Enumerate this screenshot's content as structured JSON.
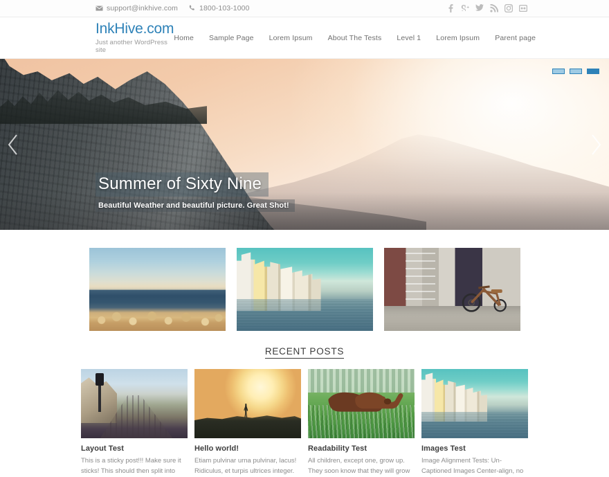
{
  "topbar": {
    "email": "support@inkhive.com",
    "phone": "1800-103-1000",
    "email_icon": "envelope-icon",
    "phone_icon": "phone-icon",
    "social": [
      {
        "name": "facebook-icon",
        "label": "f"
      },
      {
        "name": "google-plus-icon",
        "label": "g+"
      },
      {
        "name": "twitter-icon",
        "label": "t"
      },
      {
        "name": "rss-icon",
        "label": "rss"
      },
      {
        "name": "instagram-icon",
        "label": "ig"
      },
      {
        "name": "flickr-icon",
        "label": "fl"
      }
    ]
  },
  "header": {
    "site_title": "InkHive.com",
    "tagline": "Just another WordPress site",
    "nav": [
      {
        "label": "Home"
      },
      {
        "label": "Sample Page"
      },
      {
        "label": "Lorem Ipsum"
      },
      {
        "label": "About The Tests"
      },
      {
        "label": "Level 1"
      },
      {
        "label": "Lorem Ipsum"
      },
      {
        "label": "Parent page"
      }
    ]
  },
  "hero": {
    "title": "Summer of Sixty Nine",
    "subtitle": "Beautiful Weather and beautiful picture. Great Shot!",
    "prev_icon": "chevron-left-icon",
    "next_icon": "chevron-right-icon",
    "slide_count": 3,
    "active_slide": 3,
    "accent_color": "#2e82b8",
    "dot_inactive_color": "#9fcbe4",
    "image_alt": "Mountain cliff at sunset with peach sky"
  },
  "featured": [
    {
      "name": "featured-image-seascape",
      "alt": "Rocky coastline at dusk with calm sea"
    },
    {
      "name": "featured-image-canal",
      "alt": "Colourful canal houses with boats"
    },
    {
      "name": "featured-image-tricycle",
      "alt": "Vintage tricycle leaning against a brick wall"
    }
  ],
  "recent": {
    "heading": "RECENT POSTS",
    "posts": [
      {
        "title": "Layout Test",
        "excerpt": "This is a sticky post!!! Make sure it sticks! This should then split into other pages with",
        "thumb_name": "post-thumb-railway",
        "thumb_alt": "Railway track running along the coast"
      },
      {
        "title": "Hello world!",
        "excerpt": "Etiam pulvinar urna pulvinar, lacus! Ridiculus, et turpis ultrices integer. Tincidunt porttitor",
        "thumb_name": "post-thumb-sunset",
        "thumb_alt": "Person silhouetted against a golden sunset"
      },
      {
        "title": "Readability Test",
        "excerpt": "All children, except one, grow up. They soon know that they will grow up, and the way",
        "thumb_name": "post-thumb-dogs",
        "thumb_alt": "Two brown dogs sniffing in green grass"
      },
      {
        "title": "Images Test",
        "excerpt": "Image Alignment Tests: Un-Captioned Images Center-align, no caption Center-aligned image",
        "thumb_name": "post-thumb-canal",
        "thumb_alt": "Canal houses reflected in the water"
      }
    ]
  }
}
